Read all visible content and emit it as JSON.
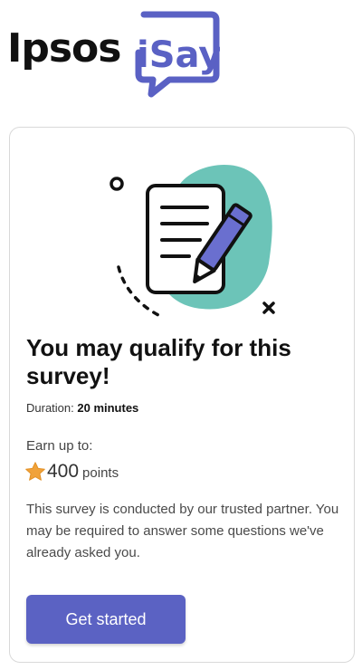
{
  "logo": {
    "brand": "Ipsos",
    "product": "iSay"
  },
  "card": {
    "illustration_icon": "survey-document-pencil-icon",
    "title": "You may qualify for this survey!",
    "duration_label": "Duration:",
    "duration_value": "20 minutes",
    "earn_label": "Earn up to:",
    "points_icon": "star-icon",
    "points_value": "400",
    "points_unit": "points",
    "disclaimer": "This survey is conducted by our trusted partner. You may be required to answer some questions we've already asked you.",
    "cta_label": "Get started"
  },
  "colors": {
    "brand_accent": "#5b62c3",
    "logo_isay": "#5a61c4",
    "blob": "#6cc4b8",
    "star": "#f0a23a",
    "pencil": "#6a6fcf"
  }
}
